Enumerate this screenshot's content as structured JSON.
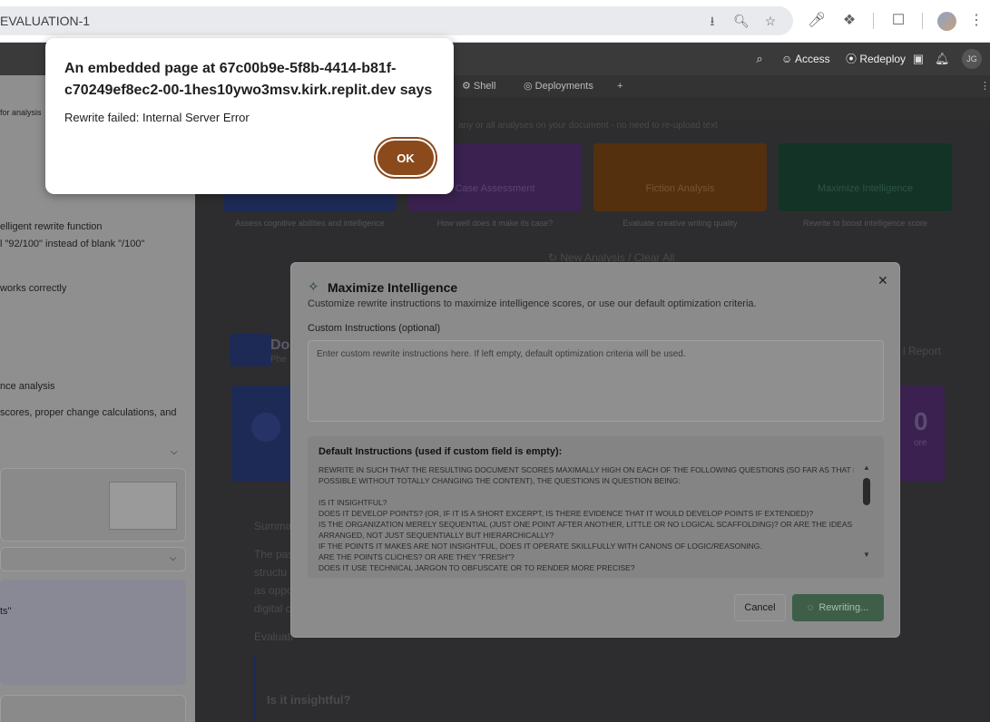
{
  "browser": {
    "url": "EVALUATION-1"
  },
  "app_header": {
    "access_label": "Access",
    "redeploy_label": "Redeploy",
    "avatar_initials": "JG"
  },
  "tabs": [
    {
      "label": "Shell"
    },
    {
      "label": "Deployments"
    },
    {
      "label": "+"
    }
  ],
  "left_panel": {
    "lines": [
      "for analysis",
      "elligent rewrite function",
      "l \"92/100\" instead of blank \"/100\"",
      "works correctly",
      "nce analysis",
      " scores, proper change calculations, and",
      "ts\""
    ]
  },
  "main": {
    "intro_text": "any or all analyses on your document - no need to re-upload text",
    "tiles": [
      {
        "label": "",
        "caption": "Assess cognitive abilities and intelligence",
        "color": "#1e2a56"
      },
      {
        "label": "Case Assessment",
        "caption": "How well does it make its case?",
        "color": "#3a2150"
      },
      {
        "label": "Fiction Analysis",
        "caption": "Evaluate creative writing quality",
        "color": "#55300f"
      },
      {
        "label": "Maximize Intelligence",
        "caption": "Rewrite to boost intelligence score",
        "color": "#123325"
      }
    ],
    "new_analysis_label": "New Analysis / Clear All",
    "doc_title": "Do",
    "doc_sub": "Phe",
    "report_label": "l Report",
    "summary_label": "Summa",
    "body_lines": [
      "The pas",
      "structu",
      "as oppo",
      "digital c"
    ],
    "evaluation_label": "Evaluati",
    "question_label": "Is it insightful?",
    "score_digit": "0",
    "score_caption": "ore"
  },
  "modal": {
    "title": "Maximize Intelligence",
    "subtitle": "Customize rewrite instructions to maximize intelligence scores, or use our default optimization criteria.",
    "custom_label": "Custom Instructions (optional)",
    "custom_placeholder": "Enter custom rewrite instructions here. If left empty, default optimization criteria will be used.",
    "default_title": "Default Instructions (used if custom field is empty):",
    "default_lines": [
      "REWRITE IN SUCH THAT THE RESULTING DOCUMENT SCORES MAXIMALLY HIGH ON EACH OF THE FOLLOWING QUESTIONS (SO FAR AS THAT IS",
      "POSSIBLE WITHOUT TOTALLY CHANGING THE CONTENT), THE QUESTIONS IN QUESTION BEING:",
      "",
      "IS IT INSIGHTFUL?",
      "DOES IT DEVELOP POINTS? (OR, IF IT IS A SHORT EXCERPT, IS THERE EVIDENCE THAT IT WOULD DEVELOP POINTS IF EXTENDED)?",
      "IS THE ORGANIZATION MERELY SEQUENTIAL (JUST ONE POINT AFTER ANOTHER, LITTLE OR NO LOGICAL SCAFFOLDING)? OR ARE THE IDEAS",
      "ARRANGED, NOT JUST SEQUENTIALLY BUT HIERARCHICALLY?",
      "IF THE POINTS IT MAKES ARE NOT INSIGHTFUL, DOES IT OPERATE SKILLFULLY WITH CANONS OF LOGIC/REASONING.",
      "ARE THE POINTS CLICHES? OR ARE THEY \"FRESH\"?",
      "DOES IT USE TECHNICAL JARGON TO OBFUSCATE OR TO RENDER MORE PRECISE?"
    ],
    "cancel_label": "Cancel",
    "rewrite_label": "Rewriting..."
  },
  "alert": {
    "title": "An embedded page at 67c00b9e-5f8b-4414-b81f-c70249ef8ec2-00-1hes10ywo3msv.kirk.replit.dev says",
    "message": "Rewrite failed: Internal Server Error",
    "ok_label": "OK"
  }
}
